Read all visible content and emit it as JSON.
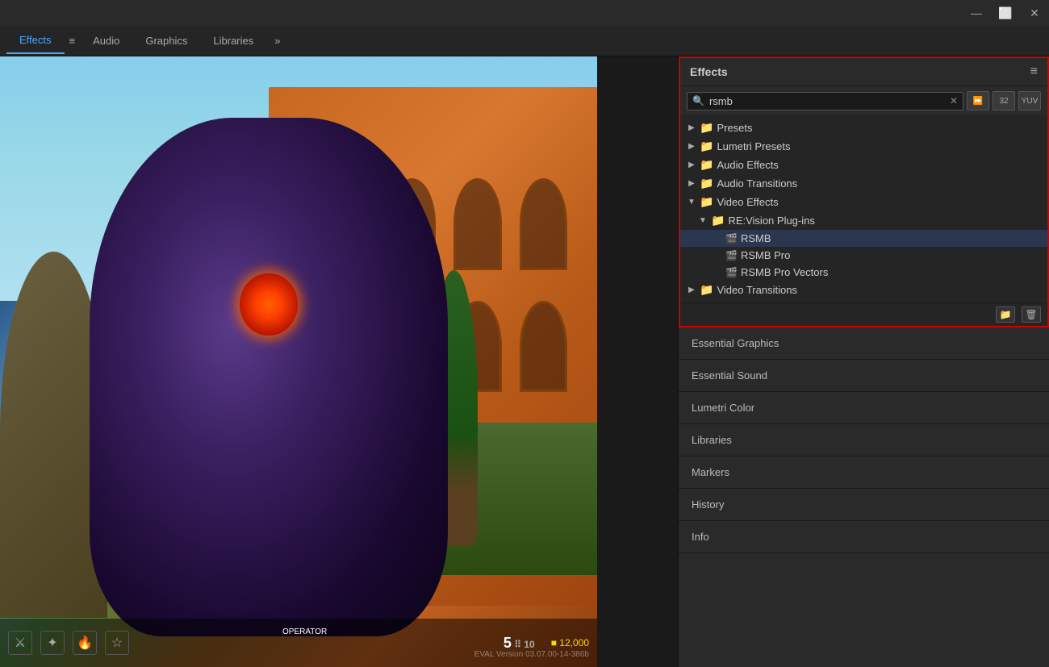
{
  "titlebar": {
    "minimize_label": "—",
    "maximize_label": "⬜",
    "close_label": "✕"
  },
  "tabbar": {
    "tabs": [
      {
        "id": "effects",
        "label": "Effects",
        "active": true
      },
      {
        "id": "audio",
        "label": "Audio",
        "active": false
      },
      {
        "id": "graphics",
        "label": "Graphics",
        "active": false
      },
      {
        "id": "libraries",
        "label": "Libraries",
        "active": false
      }
    ],
    "more_label": "»"
  },
  "effects_panel": {
    "title": "Effects",
    "menu_icon": "≡",
    "search": {
      "value": "rsmb",
      "placeholder": "Search"
    },
    "toolbar_btns": [
      {
        "id": "accel",
        "label": "⏩"
      },
      {
        "id": "bit32",
        "label": "32"
      },
      {
        "id": "yuv",
        "label": "YUV"
      }
    ],
    "tree": [
      {
        "id": "presets",
        "label": "Presets",
        "indent": 0,
        "arrow": "▶",
        "has_folder": true,
        "expanded": false
      },
      {
        "id": "lumetri",
        "label": "Lumetri Presets",
        "indent": 0,
        "arrow": "▶",
        "has_folder": true,
        "expanded": false
      },
      {
        "id": "audio-effects",
        "label": "Audio Effects",
        "indent": 0,
        "arrow": "▶",
        "has_folder": true,
        "expanded": false
      },
      {
        "id": "audio-transitions",
        "label": "Audio Transitions",
        "indent": 0,
        "arrow": "▶",
        "has_folder": true,
        "expanded": false
      },
      {
        "id": "video-effects",
        "label": "Video Effects",
        "indent": 0,
        "arrow": "▼",
        "has_folder": true,
        "expanded": true
      },
      {
        "id": "revision-plugins",
        "label": "RE:Vision Plug-ins",
        "indent": 1,
        "arrow": "▼",
        "has_folder": true,
        "expanded": true
      },
      {
        "id": "rsmb",
        "label": "RSMB",
        "indent": 2,
        "arrow": "",
        "has_folder": false,
        "selected": true
      },
      {
        "id": "rsmb-pro",
        "label": "RSMB Pro",
        "indent": 2,
        "arrow": "",
        "has_folder": false
      },
      {
        "id": "rsmb-pro-vectors",
        "label": "RSMB Pro Vectors",
        "indent": 2,
        "arrow": "",
        "has_folder": false
      },
      {
        "id": "video-transitions",
        "label": "Video Transitions",
        "indent": 0,
        "arrow": "▶",
        "has_folder": true,
        "expanded": false
      }
    ],
    "footer_btns": [
      {
        "id": "new-folder",
        "label": "📁"
      },
      {
        "id": "delete",
        "label": "🗑"
      }
    ]
  },
  "side_panels": [
    {
      "id": "essential-graphics",
      "label": "Essential Graphics"
    },
    {
      "id": "essential-sound",
      "label": "Essential Sound"
    },
    {
      "id": "lumetri-color",
      "label": "Lumetri Color"
    },
    {
      "id": "libraries",
      "label": "Libraries"
    },
    {
      "id": "markers",
      "label": "Markers"
    },
    {
      "id": "history",
      "label": "History"
    },
    {
      "id": "info",
      "label": "Info"
    }
  ],
  "hud": {
    "operator_label": "OPERATOR",
    "ammo": "5",
    "ammo_reserve": "10",
    "gold": "■ 12,000",
    "watermark": "EVAL Version 03.07.00-14-386b"
  }
}
